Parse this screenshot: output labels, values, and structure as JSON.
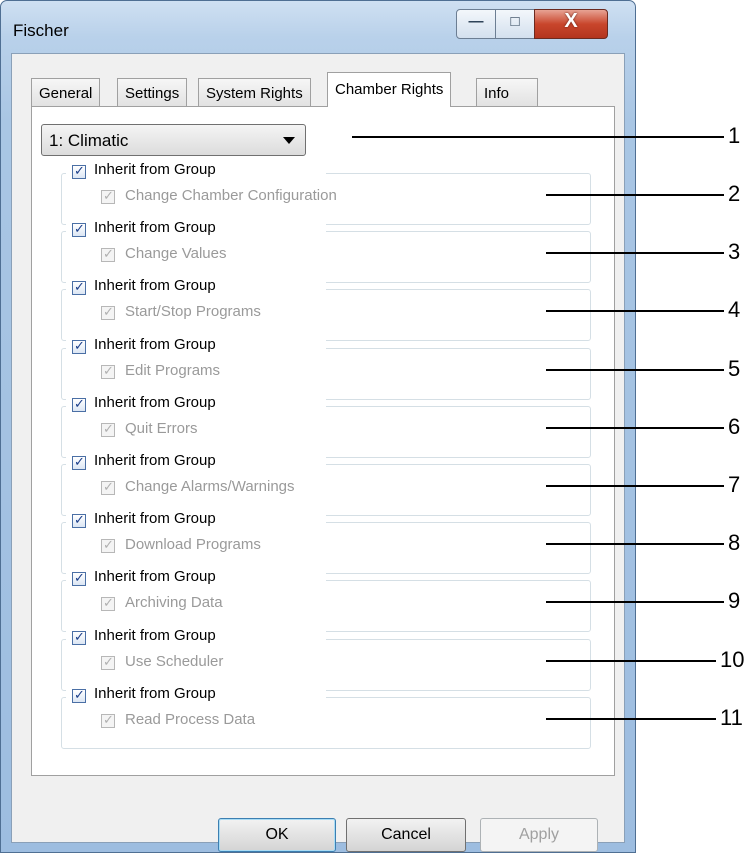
{
  "window": {
    "title": "Fischer"
  },
  "caption_buttons": {
    "minimize": "—",
    "maximize": "□",
    "close": "X"
  },
  "tabs": [
    {
      "label": "General"
    },
    {
      "label": "Settings"
    },
    {
      "label": "System Rights"
    },
    {
      "label": "Chamber Rights"
    },
    {
      "label": "Info"
    }
  ],
  "chamber_select": {
    "value": "1: Climatic"
  },
  "rights": [
    {
      "inherit_label": "Inherit from Group",
      "inherit_checked": true,
      "right_label": "Change Chamber Configuration",
      "right_checked": true,
      "right_enabled": false
    },
    {
      "inherit_label": "Inherit from Group",
      "inherit_checked": true,
      "right_label": "Change Values",
      "right_checked": true,
      "right_enabled": false
    },
    {
      "inherit_label": "Inherit from Group",
      "inherit_checked": true,
      "right_label": "Start/Stop Programs",
      "right_checked": true,
      "right_enabled": false
    },
    {
      "inherit_label": "Inherit from Group",
      "inherit_checked": true,
      "right_label": "Edit Programs",
      "right_checked": true,
      "right_enabled": false
    },
    {
      "inherit_label": "Inherit from Group",
      "inherit_checked": true,
      "right_label": "Quit Errors",
      "right_checked": true,
      "right_enabled": false
    },
    {
      "inherit_label": "Inherit from Group",
      "inherit_checked": true,
      "right_label": "Change Alarms/Warnings",
      "right_checked": true,
      "right_enabled": false
    },
    {
      "inherit_label": "Inherit from Group",
      "inherit_checked": true,
      "right_label": "Download Programs",
      "right_checked": true,
      "right_enabled": false
    },
    {
      "inherit_label": "Inherit from Group",
      "inherit_checked": true,
      "right_label": "Archiving Data",
      "right_checked": true,
      "right_enabled": false
    },
    {
      "inherit_label": "Inherit from Group",
      "inherit_checked": true,
      "right_label": "Use Scheduler",
      "right_checked": true,
      "right_enabled": false
    },
    {
      "inherit_label": "Inherit from Group",
      "inherit_checked": true,
      "right_label": "Read Process Data",
      "right_checked": true,
      "right_enabled": false
    }
  ],
  "buttons": {
    "ok": "OK",
    "cancel": "Cancel",
    "apply": "Apply"
  },
  "callouts": [
    "1",
    "2",
    "3",
    "4",
    "5",
    "6",
    "7",
    "8",
    "9",
    "10",
    "11"
  ]
}
